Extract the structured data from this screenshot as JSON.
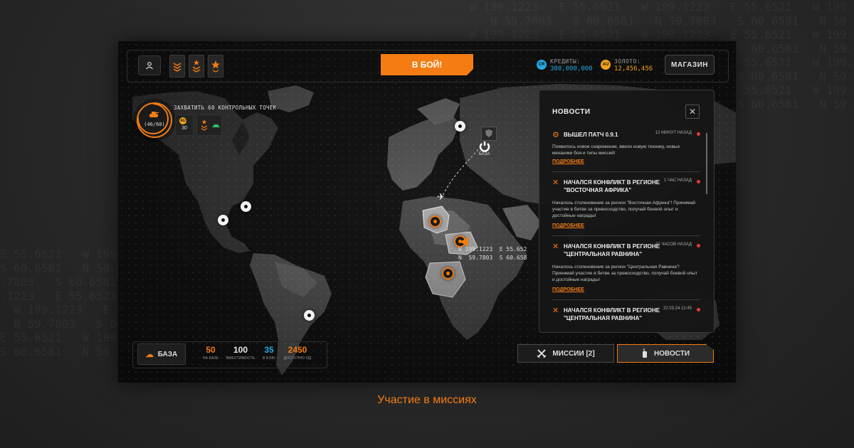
{
  "background": {
    "coords_right": "W 199.1223   E 55.6521   W 199.1223   E 55.6521   W 199.1223   E 55.6521\n   N 59.7803   S 60.6581   N 59.7803   S 60.6581   N 59.7803   S 60.6581\nW 199.1223   E 55.6521   W 199.1223   E 55.6521   W 199.1223   E 55.6521\n   N 59.7803   S 60.6581   N 59.7803   S 60.6581   N 59.7803   S 60.6581\nW 199.1223   E 55.6521   W 199.1223   E 55.6521   W 199.1223   E 55.6521\n   N 59.7803   S 60.6581   N 59.7803   S 60.6581   N 59.7803   S 60.6581\nW 199.1223   E 55.6521   W 199.1223   E 55.6521   W 199.1223   E 55.6521\n   N 59.7803   S 60.6581   N 59.7803   S 60.6581   N 59.7803   S 60.6581",
    "coords_left": "E 55.6521   W 199.1223\nS 60.6581   N 59.7803\n.7803   S 60.6581   N 59.7803\n.1223   E 55.6521   W 199.1223\n  W 199.1223   E 55.6521\n  N 59.7803   S 60.6581\nE 55.6521   W 199.1223\nS 60.6581   N 59.7803"
  },
  "topbar": {
    "fight_label": "В БОЙ!",
    "credits": {
      "icon": "CR",
      "label": "КРЕДИТЫ:",
      "value": "300,000,000",
      "color": "#27a6e0"
    },
    "gold": {
      "icon": "AU",
      "label": "ЗОЛОТО:",
      "value": "12,456,456",
      "color": "#f0a31a"
    },
    "shop_label": "МАГАЗИН"
  },
  "objective": {
    "progress_text": "(46/60)",
    "progress_fraction": 0.7667,
    "title": "ЗАХВАТИТЬ 60 КОНТРОЛЬНЫХ ТОЧЕК",
    "reward_icon": "AU",
    "reward_value": "30"
  },
  "map": {
    "base_label": "БАЗА",
    "coords_line1": "W 199.1223  E 55.652",
    "coords_line2": "N  59.7803  S 60.658"
  },
  "news": {
    "title": "НОВОСТИ",
    "more_label": "ПОДРОБНЕЕ",
    "items": [
      {
        "icon": "gear-icon",
        "headline": "ВЫШЕЛ ПАТЧ 0.9.1",
        "time": "12 МИНУТ НАЗАД",
        "body": "Появилось новое снаряжение, ввели новую технику, новые механики боя и типы миссий!"
      },
      {
        "icon": "swords-icon",
        "headline": "НАЧАЛСЯ КОНФЛИКТ В РЕГИОНЕ \"ВОСТОЧНАЯ АФРИКА\"",
        "time": "1 ЧАС НАЗАД",
        "body": "Началось столкновение за регион \"Восточная Африка\"! Принимай участие в битве за превосходство, получай боевой опыт и достойные награды!"
      },
      {
        "icon": "swords-icon",
        "headline": "НАЧАЛСЯ КОНФЛИКТ В РЕГИОНЕ \"ЦЕНТРАЛЬНАЯ РАВНИНА\"",
        "time": "12 ЧАСОВ НАЗАД",
        "body": "Началось столкновение за регион \"Центральная Равнина\"! Принимай участие в битве за превосходство, получай боевой опыт и достойные награды!"
      },
      {
        "icon": "swords-icon",
        "headline": "НАЧАЛСЯ КОНФЛИКТ В РЕГИОНЕ \"ЦЕНТРАЛЬНАЯ РАВНИНА\"",
        "time": "22.03.24 12:45",
        "body": ""
      }
    ]
  },
  "base_panel": {
    "base_label": "БАЗА",
    "stats": [
      {
        "value": "50",
        "label": "НА БАЗЕ",
        "color": "#f47c12"
      },
      {
        "value": "100",
        "label": "ВМЕСТИМОСТЬ",
        "color": "#e8e8e8"
      },
      {
        "value": "35",
        "label": "В БОЮ",
        "color": "#27a6e0"
      },
      {
        "value": "2450",
        "label": "ДОСТУПНО ОД",
        "color": "#f47c12"
      }
    ]
  },
  "tabs": {
    "missions_label": "МИССИИ [2]",
    "news_label": "НОВОСТИ"
  },
  "caption": "Участие в миссиях",
  "colors": {
    "accent": "#f47c12",
    "panel": "#161616",
    "alert": "#e23b3b"
  }
}
